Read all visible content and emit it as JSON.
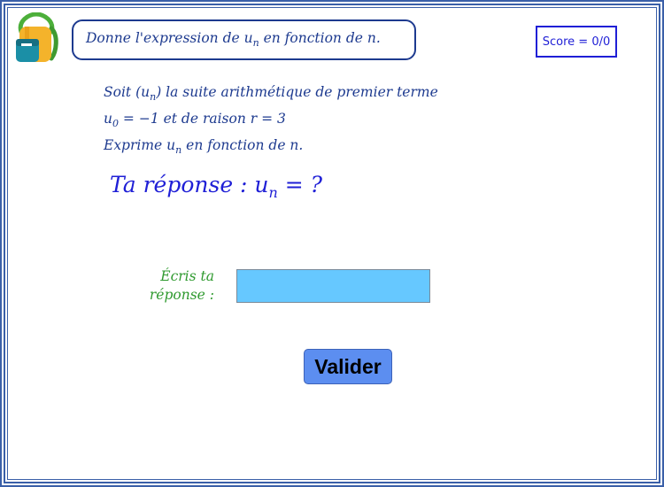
{
  "header": {
    "instruction_prefix": "Donne l'expression de u",
    "instruction_sub": "n",
    "instruction_suffix": " en fonction de n.",
    "score_label": "Score = 0/0"
  },
  "problem": {
    "line1_prefix": "Soit (u",
    "line1_sub": "n",
    "line1_suffix": ") la suite arithmétique de premier terme",
    "line2_prefix": "u",
    "line2_sub": "0",
    "line2_suffix": " = −1 et de raison r = 3",
    "line3_prefix": "Exprime u",
    "line3_sub": "n",
    "line3_suffix": " en fonction de n."
  },
  "answer": {
    "prompt_prefix": "Ta réponse : u",
    "prompt_sub": "n",
    "prompt_suffix": " = ?",
    "input_label_line1": "Écris ta",
    "input_label_line2": "réponse :",
    "input_value": ""
  },
  "actions": {
    "validate_label": "Valider"
  },
  "colors": {
    "frame": "#3a5fa8",
    "text_blue": "#1d3a8f",
    "prompt_blue": "#1f1fd6",
    "label_green": "#2f9a2f",
    "input_fill": "#66c8ff",
    "button_fill": "#5c8ef0"
  },
  "icons": {
    "logo": "backpack-icon"
  }
}
